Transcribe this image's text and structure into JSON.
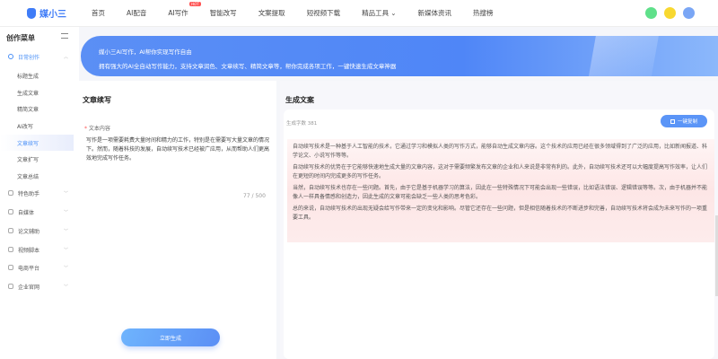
{
  "header": {
    "logo": "媒小三",
    "nav": [
      "首页",
      "AI配音",
      "AI写作",
      "智能改写",
      "文案提取",
      "短视频下载",
      "精品工具",
      "新媒体资讯",
      "热搜榜"
    ],
    "active_nav": "AI写作",
    "hot_badge": "HOT"
  },
  "sidebar": {
    "title": "创作菜单",
    "group_open": "日常创作",
    "subitems": [
      "标题生成",
      "生成文章",
      "精简文章",
      "AI改写",
      "文章续写",
      "文章扩写",
      "文章总结"
    ],
    "active_sub": "文章续写",
    "groups": [
      "特色助手",
      "自媒体",
      "论文辅助",
      "视频脚本",
      "电商平台",
      "企业官网"
    ]
  },
  "banner": {
    "line1": "媒小三AI写作，AI帮你实现写作自由",
    "line2": "拥有强大的AI全自动写作能力，支持文章润色、文章续写、精简文章等，帮你完成各项工作，一键快速生成文章神器"
  },
  "left": {
    "title": "文章续写",
    "field_label": "文本内容",
    "text": "写作是一项需要耗费大量时间和精力的工作，特别是在需要写大量文章的情况下。然而，随着科技的发展，自动续写技术已经被广应用，从而帮助人们更高效地完成写作任务。",
    "count": "77 / 500",
    "generate": "立即生成"
  },
  "right": {
    "title": "生成文案",
    "word_count": "生成字数 381",
    "copy": "一键复制",
    "paragraphs": [
      "自动续写技术是一种基于人工智能的技术，它通过学习和模拟人类的写作方式，能够自动生成文章内容。这个技术的应用已经在很多领域得到了广泛的应用，比如新闻报道、科学论文、小说写作等等。",
      "自动续写技术的优势在于它能够快速地生成大量的文章内容，这对于需要频繁发布文章的企业和人来说是非常有利的。此外，自动续写技术还可以大幅度提高写作效率，让人们在更短的时间内完成更多的写作任务。",
      "当然，自动续写技术也存在一些问题。首先，由于它是基于机器学习的算法，因此在一些特殊情况下可能会出现一些错误，比如语法错误、逻辑错误等等。次，由于机器并不能像人一样具备情感和创造力，因此生成的文章可能会缺乏一些人类的思考色彩。",
      "总的来说，自动续写技术的出现无疑会给写作带来一定的变化和影响。尽管它还存在一些问题，但是相信随着技术的不断进步和完善，自动续写技术将会成为未来写作的一项重要工具。"
    ]
  }
}
